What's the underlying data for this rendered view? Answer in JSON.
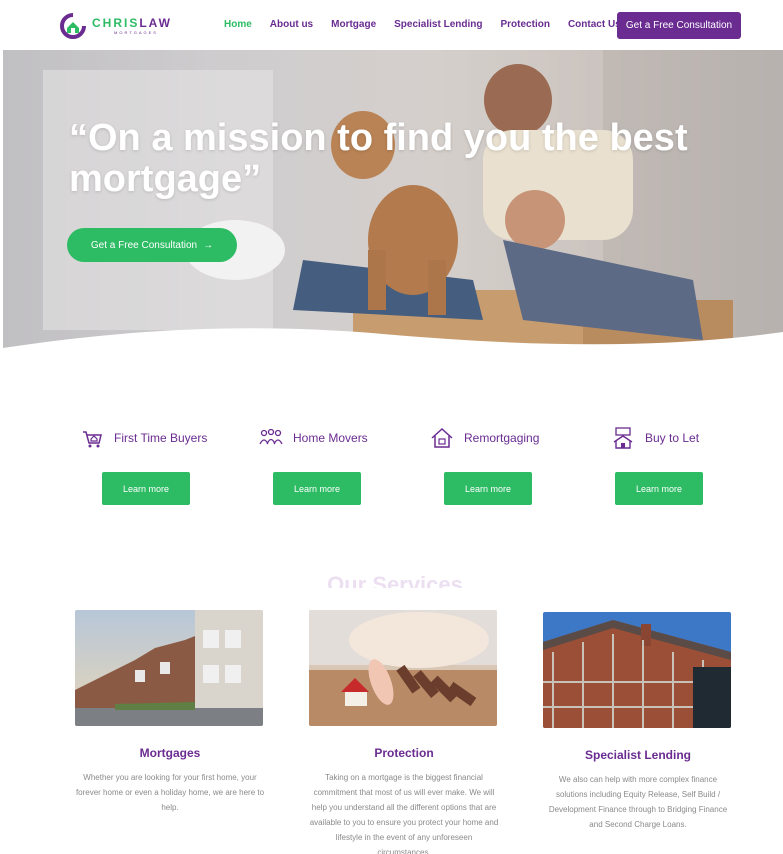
{
  "brand": {
    "name_part1": "CHRIS",
    "name_part2": "LAW",
    "tagline": "MORTGAGES",
    "primary_color": "#6a2c91",
    "accent_color": "#2dbb64"
  },
  "nav": {
    "items": [
      {
        "label": "Home",
        "active": true
      },
      {
        "label": "About us",
        "active": false
      },
      {
        "label": "Mortgage",
        "active": false
      },
      {
        "label": "Specialist Lending",
        "active": false
      },
      {
        "label": "Protection",
        "active": false
      },
      {
        "label": "Contact Us",
        "active": false
      }
    ],
    "cta_label": "Get a Free Consultation"
  },
  "hero": {
    "title": "“On a mission to find you the best mortgage”",
    "cta_label": "Get a Free Consultation",
    "cta_arrow": "→"
  },
  "services": [
    {
      "icon": "shopping-basket-icon",
      "label": "First Time Buyers",
      "button": "Learn more"
    },
    {
      "icon": "family-icon",
      "label": "Home Movers",
      "button": "Learn more"
    },
    {
      "icon": "house-icon",
      "label": "Remortgaging",
      "button": "Learn more"
    },
    {
      "icon": "rent-sign-icon",
      "label": "Buy to Let",
      "button": "Learn more"
    }
  ],
  "section": {
    "title": "Our Services"
  },
  "cards": [
    {
      "title": "Mortgages",
      "text": "Whether you are looking for your first home, your forever home or even a holiday home, we are here to help."
    },
    {
      "title": "Protection",
      "text": "Taking on a mortgage is the biggest financial commitment that most of us will ever make. We will help you understand all the different options that are available to you to ensure you protect your home and lifestyle in the event of any unforeseen circumstances."
    },
    {
      "title": "Specialist Lending",
      "text": "We also can help with more complex finance solutions including Equity Release, Self Build / Development Finance through to Bridging Finance and Second Charge Loans."
    }
  ]
}
